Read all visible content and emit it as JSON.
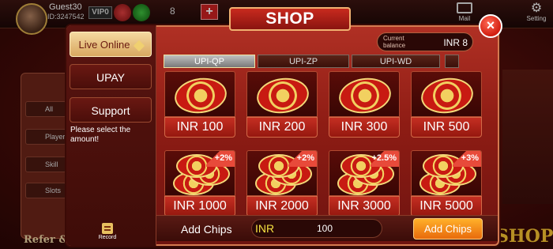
{
  "header": {
    "guest_name": "Guest30",
    "user_id": "ID:3247542",
    "vip": "VIP0",
    "balance_count": "8",
    "plus": "+",
    "mail_label": "Mail",
    "setting_label": "Setting"
  },
  "background": {
    "left_items": [
      "All",
      "Player",
      "Skill",
      "Slots"
    ],
    "refer_label": "Refer &",
    "shop_logo": "SHOP"
  },
  "shop": {
    "title": "SHOP",
    "close": "×",
    "current_balance_label_line1": "Current",
    "current_balance_label_line2": "balance",
    "current_balance_value": "INR 8"
  },
  "sidebar": {
    "live_online": "Live Online",
    "upay": "UPAY",
    "support": "Support",
    "hint": "Please select the amount!",
    "record": "Record"
  },
  "tabs": [
    {
      "label": "UPI-QP",
      "active": true
    },
    {
      "label": "UPI-ZP",
      "active": false
    },
    {
      "label": "UPI-WD",
      "active": false
    },
    {
      "label": "",
      "active": false
    }
  ],
  "packages": [
    {
      "price": "INR 100",
      "bonus": ""
    },
    {
      "price": "INR 200",
      "bonus": ""
    },
    {
      "price": "INR 300",
      "bonus": ""
    },
    {
      "price": "INR 500",
      "bonus": ""
    },
    {
      "price": "INR 1000",
      "bonus": "+2%"
    },
    {
      "price": "INR 2000",
      "bonus": "+2%"
    },
    {
      "price": "INR 3000",
      "bonus": "+2.5%"
    },
    {
      "price": "INR 5000",
      "bonus": "+3%"
    }
  ],
  "bottom": {
    "add_chips_label": "Add Chips",
    "currency": "INR",
    "amount": "100",
    "add_button": "Add Chips"
  }
}
